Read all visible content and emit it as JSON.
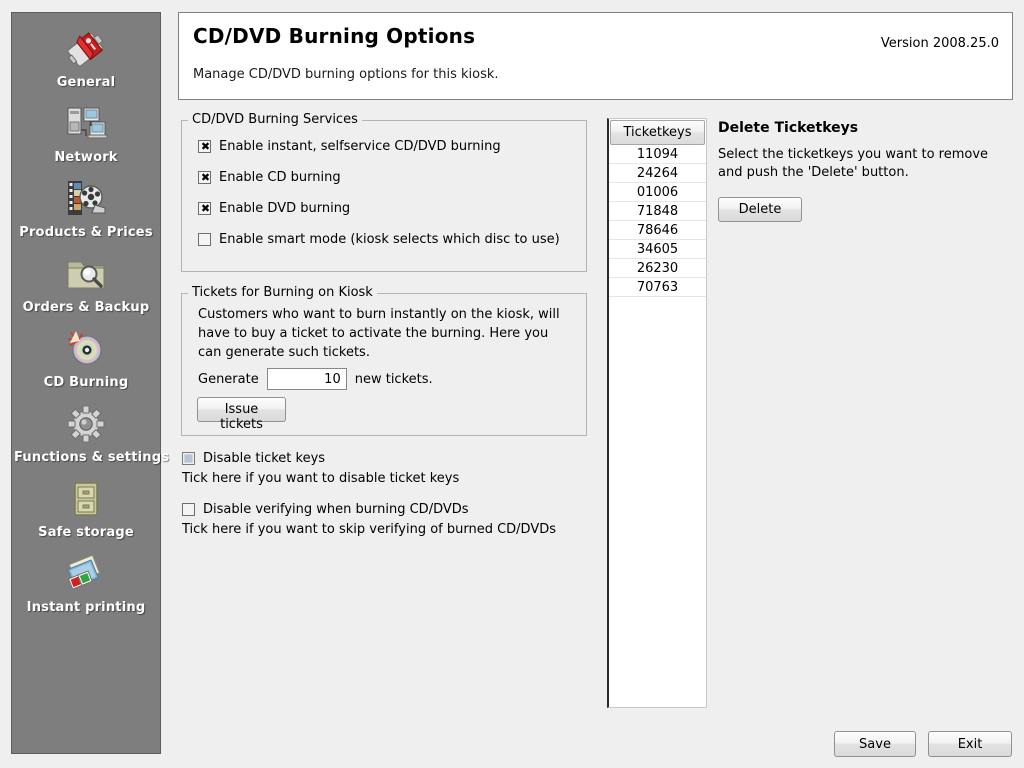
{
  "header": {
    "title": "CD/DVD Burning Options",
    "subtitle": "Manage CD/DVD burning options for this kiosk.",
    "version": "Version 2008.25.0"
  },
  "sidebar": {
    "items": [
      {
        "label": "General",
        "icon": "book-switch-icon"
      },
      {
        "label": "Network",
        "icon": "network-computers-icon"
      },
      {
        "label": "Products & Prices",
        "icon": "film-reel-icon"
      },
      {
        "label": "Orders & Backup",
        "icon": "folder-search-icon"
      },
      {
        "label": "CD Burning",
        "icon": "compact-disc-icon"
      },
      {
        "label": "Functions & settings",
        "icon": "gear-icon"
      },
      {
        "label": "Safe storage",
        "icon": "filing-cabinet-icon"
      },
      {
        "label": "Instant printing",
        "icon": "photo-prints-icon"
      }
    ]
  },
  "services": {
    "legend": "CD/DVD Burning Services",
    "checkboxes": [
      {
        "label": "Enable instant, selfservice CD/DVD burning",
        "checked": true
      },
      {
        "label": "Enable CD burning",
        "checked": true
      },
      {
        "label": "Enable DVD burning",
        "checked": true
      },
      {
        "label": "Enable smart mode (kiosk selects which disc to use)",
        "checked": false
      }
    ]
  },
  "tickets": {
    "legend": "Tickets for Burning on Kiosk",
    "description": "Customers who want to burn instantly on the kiosk, will have to buy a ticket to activate the burning. Here you can generate such tickets.",
    "generate_prefix": "Generate",
    "generate_value": "10",
    "generate_placeholder": "",
    "generate_suffix": "new tickets.",
    "issue_button": "Issue tickets"
  },
  "options": {
    "disable_ticket_keys": {
      "label": "Disable ticket keys",
      "hint": "Tick here if you want to disable ticket keys",
      "checked": false,
      "focused": true
    },
    "disable_verifying": {
      "label": "Disable verifying when burning CD/DVDs",
      "hint": "Tick here if you want to skip verifying of burned CD/DVDs",
      "checked": false,
      "focused": false
    }
  },
  "ticketkeys": {
    "column_header": "Ticketkeys",
    "rows": [
      "11094",
      "24264",
      "01006",
      "71848",
      "78646",
      "34605",
      "26230",
      "70763"
    ]
  },
  "delete_panel": {
    "title": "Delete Ticketkeys",
    "description": "Select the ticketkeys you want to remove and push the 'Delete' button.",
    "button": "Delete"
  },
  "footer": {
    "save": "Save",
    "exit": "Exit"
  },
  "colors": {
    "sidebar_bg": "#7e7e7e",
    "page_bg": "#efefef",
    "panel_bg": "#ffffff",
    "focus_fill": "#b9c4d2"
  }
}
